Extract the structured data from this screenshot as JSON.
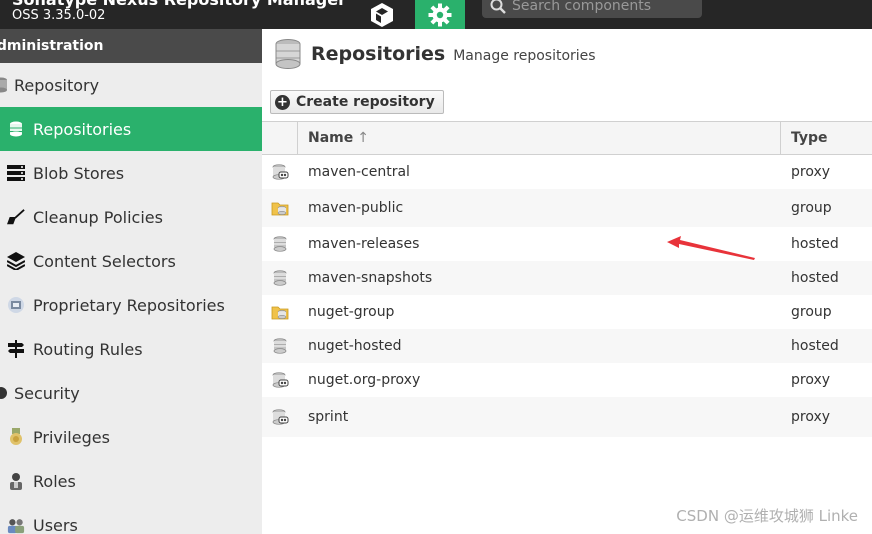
{
  "app": {
    "title": "Sonatype Nexus Repository Manager",
    "version": "OSS 3.35.0-02"
  },
  "topbar": {
    "browse_icon": "cube-icon",
    "admin_icon": "gear-icon",
    "search_placeholder": "Search components"
  },
  "sidebar": {
    "header": "Administration",
    "items": [
      {
        "label": "Repository",
        "icon": "database-icon",
        "level": 0,
        "active": false
      },
      {
        "label": "Repositories",
        "icon": "database-icon",
        "level": 1,
        "active": true
      },
      {
        "label": "Blob Stores",
        "icon": "server-stack-icon",
        "level": 1,
        "active": false
      },
      {
        "label": "Cleanup Policies",
        "icon": "broom-icon",
        "level": 1,
        "active": false
      },
      {
        "label": "Content Selectors",
        "icon": "layers-icon",
        "level": 1,
        "active": false
      },
      {
        "label": "Proprietary Repositories",
        "icon": "proprietary-icon",
        "level": 1,
        "active": false
      },
      {
        "label": "Routing Rules",
        "icon": "signpost-icon",
        "level": 1,
        "active": false
      },
      {
        "label": "Security",
        "icon": "security-icon",
        "level": 0,
        "active": false
      },
      {
        "label": "Privileges",
        "icon": "medal-icon",
        "level": 1,
        "active": false
      },
      {
        "label": "Roles",
        "icon": "user-role-icon",
        "level": 1,
        "active": false
      },
      {
        "label": "Users",
        "icon": "users-icon",
        "level": 1,
        "active": false
      }
    ]
  },
  "main": {
    "title": "Repositories",
    "subtitle": "Manage repositories",
    "create_button": "Create repository",
    "columns": {
      "name": "Name",
      "sort_indicator": "↑",
      "type": "Type"
    },
    "rows": [
      {
        "name": "maven-central",
        "type": "proxy",
        "icon": "proxy-repo-icon"
      },
      {
        "name": "maven-public",
        "type": "group",
        "icon": "group-repo-icon"
      },
      {
        "name": "maven-releases",
        "type": "hosted",
        "icon": "hosted-repo-icon"
      },
      {
        "name": "maven-snapshots",
        "type": "hosted",
        "icon": "hosted-repo-icon"
      },
      {
        "name": "nuget-group",
        "type": "group",
        "icon": "group-repo-icon"
      },
      {
        "name": "nuget-hosted",
        "type": "hosted",
        "icon": "hosted-repo-icon"
      },
      {
        "name": "nuget.org-proxy",
        "type": "proxy",
        "icon": "proxy-repo-icon"
      },
      {
        "name": "sprint",
        "type": "proxy",
        "icon": "proxy-repo-icon"
      }
    ]
  },
  "annotation": {
    "color": "#e8333a",
    "target": "maven-public"
  },
  "watermark": "CSDN @运维攻城狮 Linke",
  "colors": {
    "accent": "#2ab16c",
    "topbar": "#262626",
    "sidebar": "#ededed"
  }
}
